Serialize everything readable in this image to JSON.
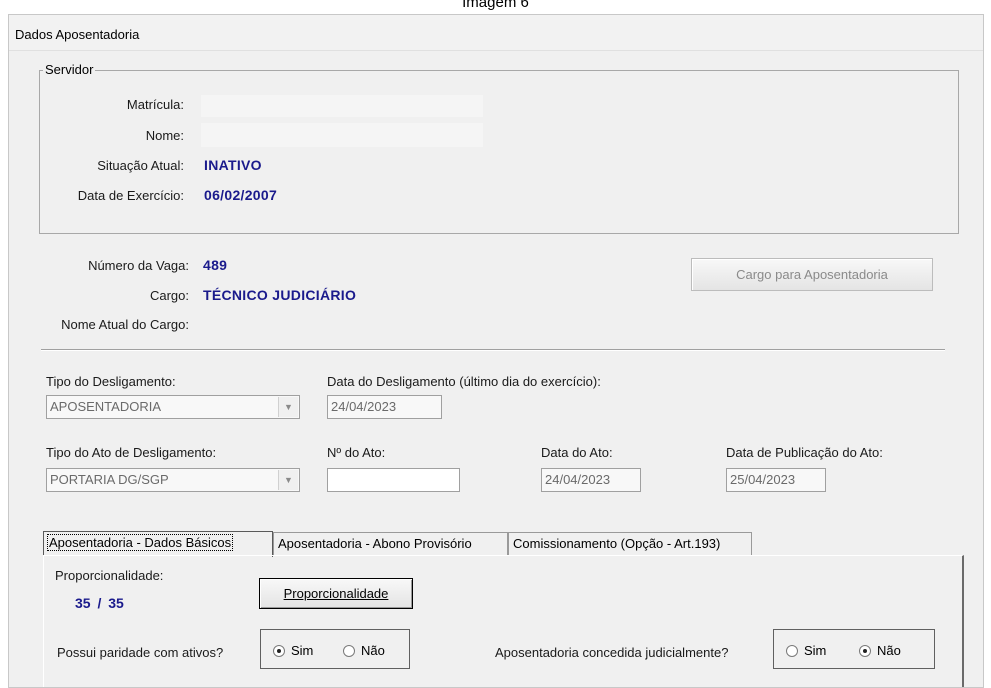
{
  "caption": "Imagem 6",
  "window": {
    "title": "Dados Aposentadoria"
  },
  "servidor": {
    "group_title": "Servidor",
    "matricula_label": "Matrícula:",
    "nome_label": "Nome:",
    "situacao_label": "Situação Atual:",
    "situacao_value": "INATIVO",
    "exercicio_label": "Data de Exercício:",
    "exercicio_value": "06/02/2007"
  },
  "vaga": {
    "numero_label": "Número da Vaga:",
    "numero_value": "489",
    "cargo_label": "Cargo:",
    "cargo_value": "TÉCNICO JUDICIÁRIO",
    "nome_atual_label": "Nome Atual do Cargo:",
    "cargo_button": "Cargo para Aposentadoria"
  },
  "desligamento": {
    "tipo_label": "Tipo do Desligamento:",
    "tipo_value": "APOSENTADORIA",
    "data_label": "Data do Desligamento (último dia do exercício):",
    "data_value": "24/04/2023",
    "tipo_ato_label": "Tipo do Ato de Desligamento:",
    "tipo_ato_value": "PORTARIA DG/SGP",
    "numero_ato_label": "Nº do Ato:",
    "numero_ato_value": "",
    "data_ato_label": "Data do Ato:",
    "data_ato_value": "24/04/2023",
    "publicacao_label": "Data de Publicação do Ato:",
    "publicacao_value": "25/04/2023"
  },
  "tabs": [
    {
      "label": "Aposentadoria - Dados Básicos",
      "active": true
    },
    {
      "label": "Aposentadoria - Abono Provisório",
      "active": false
    },
    {
      "label": "Comissionamento (Opção - Art.193)",
      "active": false
    }
  ],
  "dados_basicos": {
    "proporcionalidade_label": "Proporcionalidade:",
    "proporcionalidade_num": "35",
    "proporcionalidade_sep": "/",
    "proporcionalidade_den": "35",
    "proporcionalidade_button": "Proporcionalidade",
    "paridade_label": "Possui paridade com ativos?",
    "paridade_sim": "Sim",
    "paridade_nao": "Não",
    "paridade_selected": "Sim",
    "judicial_label": "Aposentadoria concedida judicialmente?",
    "judicial_sim": "Sim",
    "judicial_nao": "Não",
    "judicial_selected": "Não"
  },
  "colors": {
    "value_text": "#1a1a8c",
    "window_bg": "#f0f0f0",
    "disabled_text": "#8a8a8a"
  },
  "icons": {
    "combo_arrow": "chevron-down-icon"
  }
}
